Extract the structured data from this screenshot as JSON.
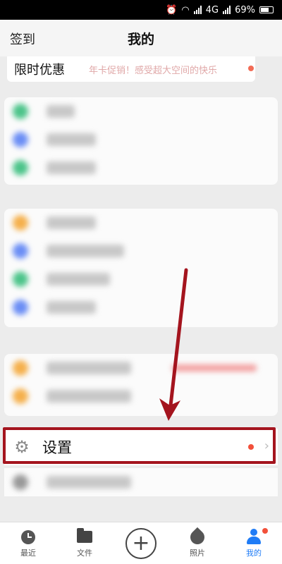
{
  "status_bar": {
    "network": "4G",
    "battery": "69%"
  },
  "header": {
    "left_action": "签到",
    "title": "我的"
  },
  "promo": {
    "label": "限时优惠",
    "text": "年卡促销！感受超大空间的快乐"
  },
  "settings": {
    "label": "设置",
    "icon": "gear-icon"
  },
  "tabs": [
    {
      "label": "最近",
      "icon": "clock-icon"
    },
    {
      "label": "文件",
      "icon": "folder-icon"
    },
    {
      "label": "",
      "icon": "plus-icon"
    },
    {
      "label": "照片",
      "icon": "leaf-icon"
    },
    {
      "label": "我的",
      "icon": "person-icon"
    }
  ],
  "colors": {
    "accent": "#1f7cf6",
    "highlight_box": "#a4141e",
    "notification_dot": "#f2503a"
  }
}
